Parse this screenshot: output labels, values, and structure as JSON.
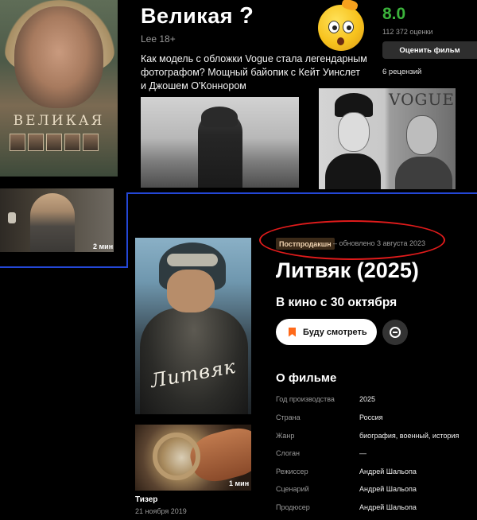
{
  "top_film": {
    "title": "Великая",
    "title_question_mark": "?",
    "poster_title": "ВЕЛИКАЯ",
    "subtitle": "Lee 18+",
    "description": "Как модель с обложки Vogue стала легендарным фотографом? Мощный байопик с Кейт Уинслет и Джошем О'Коннором",
    "rating": "8.0",
    "votes": "112 372 оценки",
    "rate_button": "Оценить фильм",
    "reviews": "6 рецензий",
    "photo2_magazine": "VOGUE",
    "trailer_duration": "2 мин",
    "emoji": "confused-face-emoji"
  },
  "film": {
    "status_badge": "Постпродакшн",
    "updated": "– обновлено 3 августа 2023",
    "title": "Литвяк (2025)",
    "poster_name": "Литвяк",
    "release": "В кино с 30 октября",
    "watch_button": "Буду смотреть",
    "about_heading": "О фильме",
    "specs": [
      {
        "label": "Год производства",
        "value": "2025"
      },
      {
        "label": "Страна",
        "value": "Россия"
      },
      {
        "label": "Жанр",
        "value": "биография, военный, история"
      },
      {
        "label": "Слоган",
        "value": "—"
      },
      {
        "label": "Режиссер",
        "value": "Андрей Шальопа"
      },
      {
        "label": "Сценарий",
        "value": "Андрей Шальопа"
      },
      {
        "label": "Продюсер",
        "value": "Андрей Шальопа"
      }
    ],
    "teaser": {
      "label": "Тизер",
      "date": "21 ноября 2019",
      "duration": "1 мин"
    }
  },
  "colors": {
    "rating_green": "#3bb33b",
    "accent_orange": "#ff6a1a",
    "annotation_red": "#e01b1b",
    "divider_blue": "#2447d6"
  }
}
